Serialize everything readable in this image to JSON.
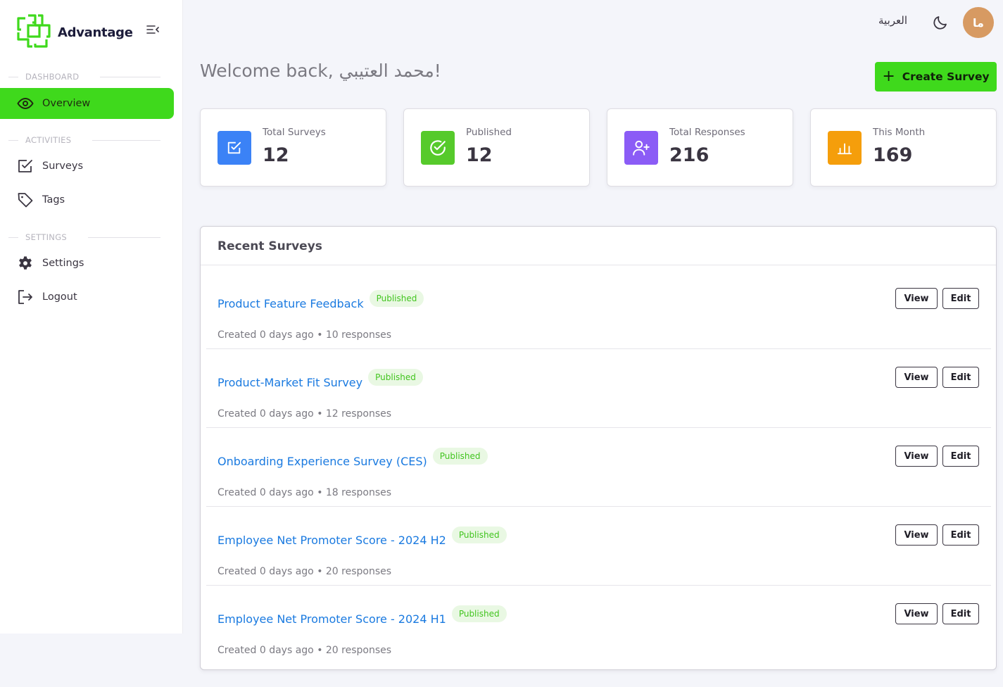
{
  "brand": {
    "name": "Advantage",
    "accent": "#3fd91c"
  },
  "sidebar": {
    "sections": [
      {
        "title": "DASHBOARD"
      },
      {
        "title": "ACTIVITIES"
      },
      {
        "title": "SETTINGS"
      }
    ],
    "items": [
      {
        "label": "Overview",
        "icon": "eye-icon",
        "active": true
      },
      {
        "label": "Surveys",
        "icon": "checkbox-icon"
      },
      {
        "label": "Tags",
        "icon": "tag-icon"
      },
      {
        "label": "Settings",
        "icon": "gear-icon"
      },
      {
        "label": "Logout",
        "icon": "logout-icon"
      }
    ]
  },
  "topbar": {
    "language": "العربية",
    "theme_icon": "moon-icon",
    "avatar_initials": "ما"
  },
  "page": {
    "welcome": "Welcome back, محمد العتيبي!",
    "create_button": "Create Survey"
  },
  "stats": [
    {
      "label": "Total Surveys",
      "value": "12",
      "color": "#3b82f6",
      "icon": "checkbox-icon"
    },
    {
      "label": "Published",
      "value": "12",
      "color": "#56ca2b",
      "icon": "check-circle-icon"
    },
    {
      "label": "Total Responses",
      "value": "216",
      "color": "#8b5cf6",
      "icon": "user-plus-icon"
    },
    {
      "label": "This Month",
      "value": "169",
      "color": "#f59e0b",
      "icon": "bar-chart-icon"
    }
  ],
  "recent": {
    "title": "Recent Surveys",
    "view_label": "View",
    "edit_label": "Edit",
    "surveys": [
      {
        "title": "Product Feature Feedback",
        "status": "Published",
        "meta": "Created 0 days ago • 10 responses"
      },
      {
        "title": "Product-Market Fit Survey",
        "status": "Published",
        "meta": "Created 0 days ago • 12 responses"
      },
      {
        "title": "Onboarding Experience Survey (CES)",
        "status": "Published",
        "meta": "Created 0 days ago • 18 responses"
      },
      {
        "title": "Employee Net Promoter Score - 2024 H2",
        "status": "Published",
        "meta": "Created 0 days ago • 20 responses"
      },
      {
        "title": "Employee Net Promoter Score - 2024 H1",
        "status": "Published",
        "meta": "Created 0 days ago • 20 responses"
      }
    ]
  }
}
